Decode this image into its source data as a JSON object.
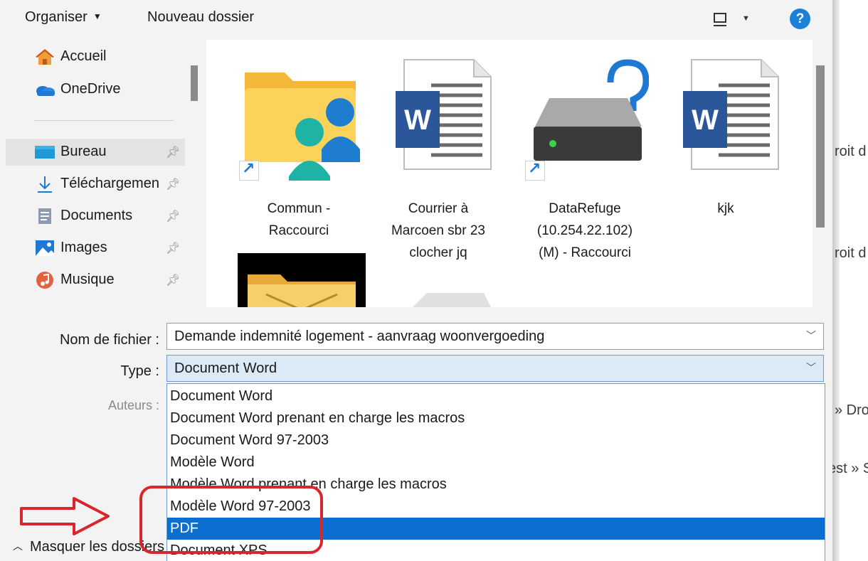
{
  "toolbar": {
    "organise_label": "Organiser",
    "new_folder_label": "Nouveau dossier",
    "help_label": "?"
  },
  "nav": {
    "quick": [
      {
        "label": "Accueil",
        "icon": "home-icon"
      },
      {
        "label": "OneDrive",
        "icon": "cloud-icon"
      }
    ],
    "pinned": [
      {
        "label": "Bureau",
        "icon": "desktop-icon",
        "selected": true
      },
      {
        "label": "Téléchargemen",
        "icon": "download-icon"
      },
      {
        "label": "Documents",
        "icon": "documents-icon"
      },
      {
        "label": "Images",
        "icon": "images-icon"
      },
      {
        "label": "Musique",
        "icon": "music-icon"
      }
    ]
  },
  "files": [
    {
      "name_lines": [
        "Commun -",
        "Raccourci"
      ],
      "icon": "shared-folder-icon",
      "shortcut": true
    },
    {
      "name_lines": [
        "Courrier à",
        "Marcoen sbr 23",
        "clocher jq"
      ],
      "icon": "word-document-icon",
      "shortcut": false
    },
    {
      "name_lines": [
        "DataRefuge",
        "(10.254.22.102)",
        "(M) - Raccourci"
      ],
      "icon": "network-drive-icon",
      "shortcut": true
    },
    {
      "name_lines": [
        "kjk"
      ],
      "icon": "word-document-icon",
      "shortcut": false
    }
  ],
  "form": {
    "filename_label": "Nom de fichier :",
    "filename_value": "Demande indemnité logement - aanvraag woonvergoeding",
    "type_label": "Type :",
    "type_value": "Document Word",
    "authors_label": "Auteurs :"
  },
  "type_options": [
    "Document Word",
    "Document Word prenant en charge les macros",
    "Document Word 97-2003",
    "Modèle Word",
    "Modèle Word prenant en charge les macros",
    "Modèle Word 97-2003",
    "PDF",
    "Document XPS"
  ],
  "selected_option": "PDF",
  "hide_folders_label": "Masquer les dossiers",
  "background_fragments": [
    "roit d",
    "roit d",
    "» Dro",
    "est » S"
  ],
  "colors": {
    "accent": "#0a6fd1",
    "annotation": "#d8262c"
  }
}
